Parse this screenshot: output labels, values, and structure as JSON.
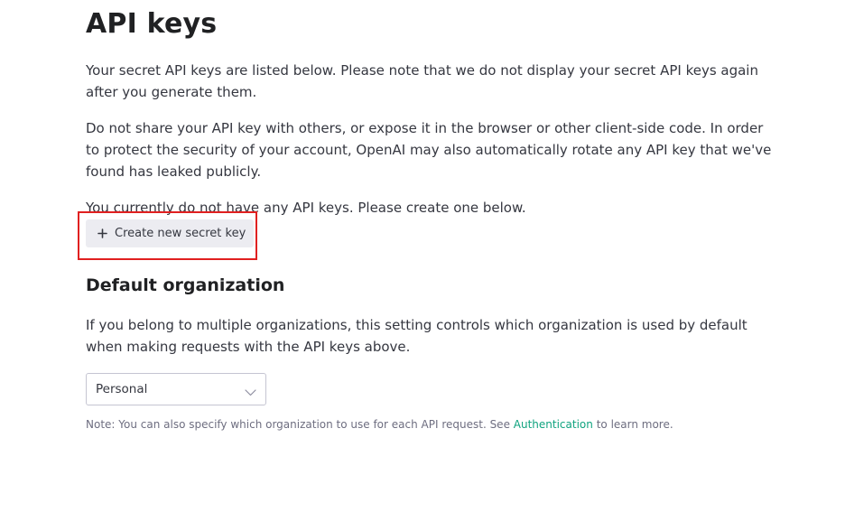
{
  "page": {
    "title": "API keys"
  },
  "intro": {
    "paragraph1": "Your secret API keys are listed below. Please note that we do not display your secret API keys again after you generate them.",
    "paragraph2": "Do not share your API key with others, or expose it in the browser or other client-side code. In order to protect the security of your account, OpenAI may also automatically rotate any API key that we've found has leaked publicly.",
    "empty_state": "You currently do not have any API keys. Please create one below."
  },
  "create_button": {
    "icon": "plus-icon",
    "label": "Create new secret key"
  },
  "default_org": {
    "heading": "Default organization",
    "description": "If you belong to multiple organizations, this setting controls which organization is used by default when making requests with the API keys above.",
    "select_value": "Personal",
    "select_icon": "chevron-down-icon"
  },
  "note": {
    "prefix": "Note: You can also specify which organization to use for each API request. See",
    "link_text": "Authentication",
    "suffix": "to learn more."
  },
  "colors": {
    "link": "#10a37f",
    "highlight": "#e02020",
    "button_bg": "#ececf1"
  }
}
